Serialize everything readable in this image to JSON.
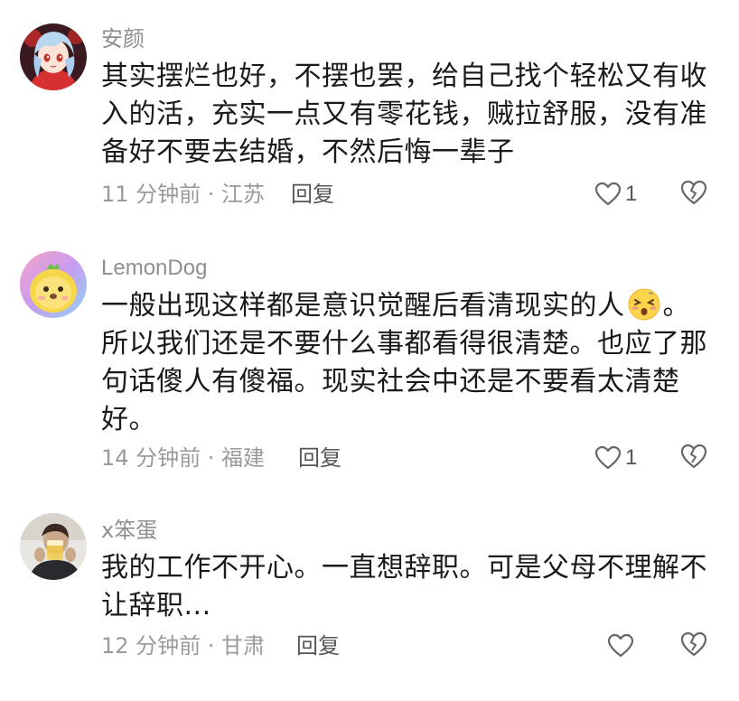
{
  "comments": [
    {
      "username": "安颜",
      "lines": [
        "其实摆烂也好，不摆也罢，给自己找个轻松又有收",
        "入的活，充实一点又有零花钱，贼拉舒服，没有准",
        "备好不要去结婚，不然后悔一辈子"
      ],
      "meta": "11 分钟前 · 江苏",
      "reply_label": "回复",
      "like_count": "1",
      "avatar_icon": "anime-girl-avatar",
      "icons": {
        "like": "heart-outline-icon",
        "dislike": "broken-heart-icon"
      }
    },
    {
      "username": "LemonDog",
      "lines": [
        "一般出现这样都是意识觉醒后看清现实的人",
        "所以我们还是不要什么事都看得很清楚。也应了那",
        "句话傻人有傻福。现实社会中还是不要看太清楚",
        "好。"
      ],
      "line1_suffix": "。",
      "emoji": "dizzy-face-emoji",
      "meta": "14 分钟前 · 福建",
      "reply_label": "回复",
      "like_count": "1",
      "avatar_icon": "yellow-dog-avatar",
      "icons": {
        "like": "heart-outline-icon",
        "dislike": "broken-heart-icon"
      }
    },
    {
      "username": "x笨蛋",
      "lines": [
        "我的工作不开心。一直想辞职。可是父母不理解不",
        "让辞职..."
      ],
      "meta": "12 分钟前 · 甘肃",
      "reply_label": "回复",
      "like_count": "",
      "avatar_icon": "person-drinking-avatar",
      "icons": {
        "like": "heart-outline-icon",
        "dislike": "broken-heart-icon"
      }
    }
  ],
  "colors": {
    "text": "#1a1a1a",
    "meta": "#9a9a9e",
    "username": "#8e8e93",
    "icon": "#666666"
  }
}
